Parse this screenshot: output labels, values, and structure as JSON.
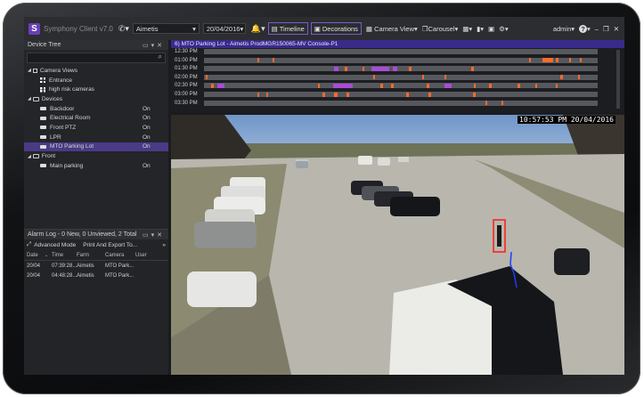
{
  "app": {
    "logo_letter": "S",
    "title": "Symphony Client v7.0"
  },
  "toolbar": {
    "server_select": "Aimetis",
    "date_select": "20/04/2016",
    "timeline_label": "Timeline",
    "decorations_label": "Decorations",
    "camera_view_label": "Camera View",
    "carousel_label": "Carousel",
    "user_label": "admin",
    "help_label": "?"
  },
  "device_tree": {
    "header": "Device Tree",
    "items": [
      {
        "label": "Camera Views",
        "state": ""
      },
      {
        "label": "Entrance",
        "state": ""
      },
      {
        "label": "high risk cameras",
        "state": ""
      },
      {
        "label": "Devices",
        "state": ""
      },
      {
        "label": "Backdoor",
        "state": "On"
      },
      {
        "label": "Electrical Room",
        "state": "On"
      },
      {
        "label": "Front PTZ",
        "state": "On"
      },
      {
        "label": "LPR",
        "state": "On"
      },
      {
        "label": "MTO Parking Lot",
        "state": "On"
      },
      {
        "label": "Front",
        "state": ""
      },
      {
        "label": "Main parking",
        "state": "On"
      }
    ]
  },
  "alarm_log": {
    "header": "Alarm Log - 0 New, 0 Unviewed, 2 Total",
    "advanced_mode": "Advanced Mode",
    "print_export": "Print And Export To...",
    "columns": [
      "Date",
      "Time",
      "Farm",
      "Camera",
      "User"
    ],
    "rows": [
      [
        "20/04",
        "07:39:28...",
        "Aimetis",
        "MTO Park...",
        ""
      ],
      [
        "20/04",
        "04:48:28...",
        "Aimetis",
        "MTO Park...",
        ""
      ]
    ]
  },
  "camera": {
    "title": "6) MTO Parking Lot - Aimetis ProdMGR150065-MV Console-P1",
    "timestamp": "10:57:53 PM 20/04/2016"
  },
  "timeline": {
    "rows": [
      "12:30 PM",
      "01:00 PM",
      "01:30 PM",
      "02:00 PM",
      "02:30 PM",
      "03:00 PM",
      "03:30 PM"
    ],
    "colors": {
      "bar": "#56585d",
      "orange": "#ff6a2a",
      "purple": "#a84cd9"
    }
  }
}
